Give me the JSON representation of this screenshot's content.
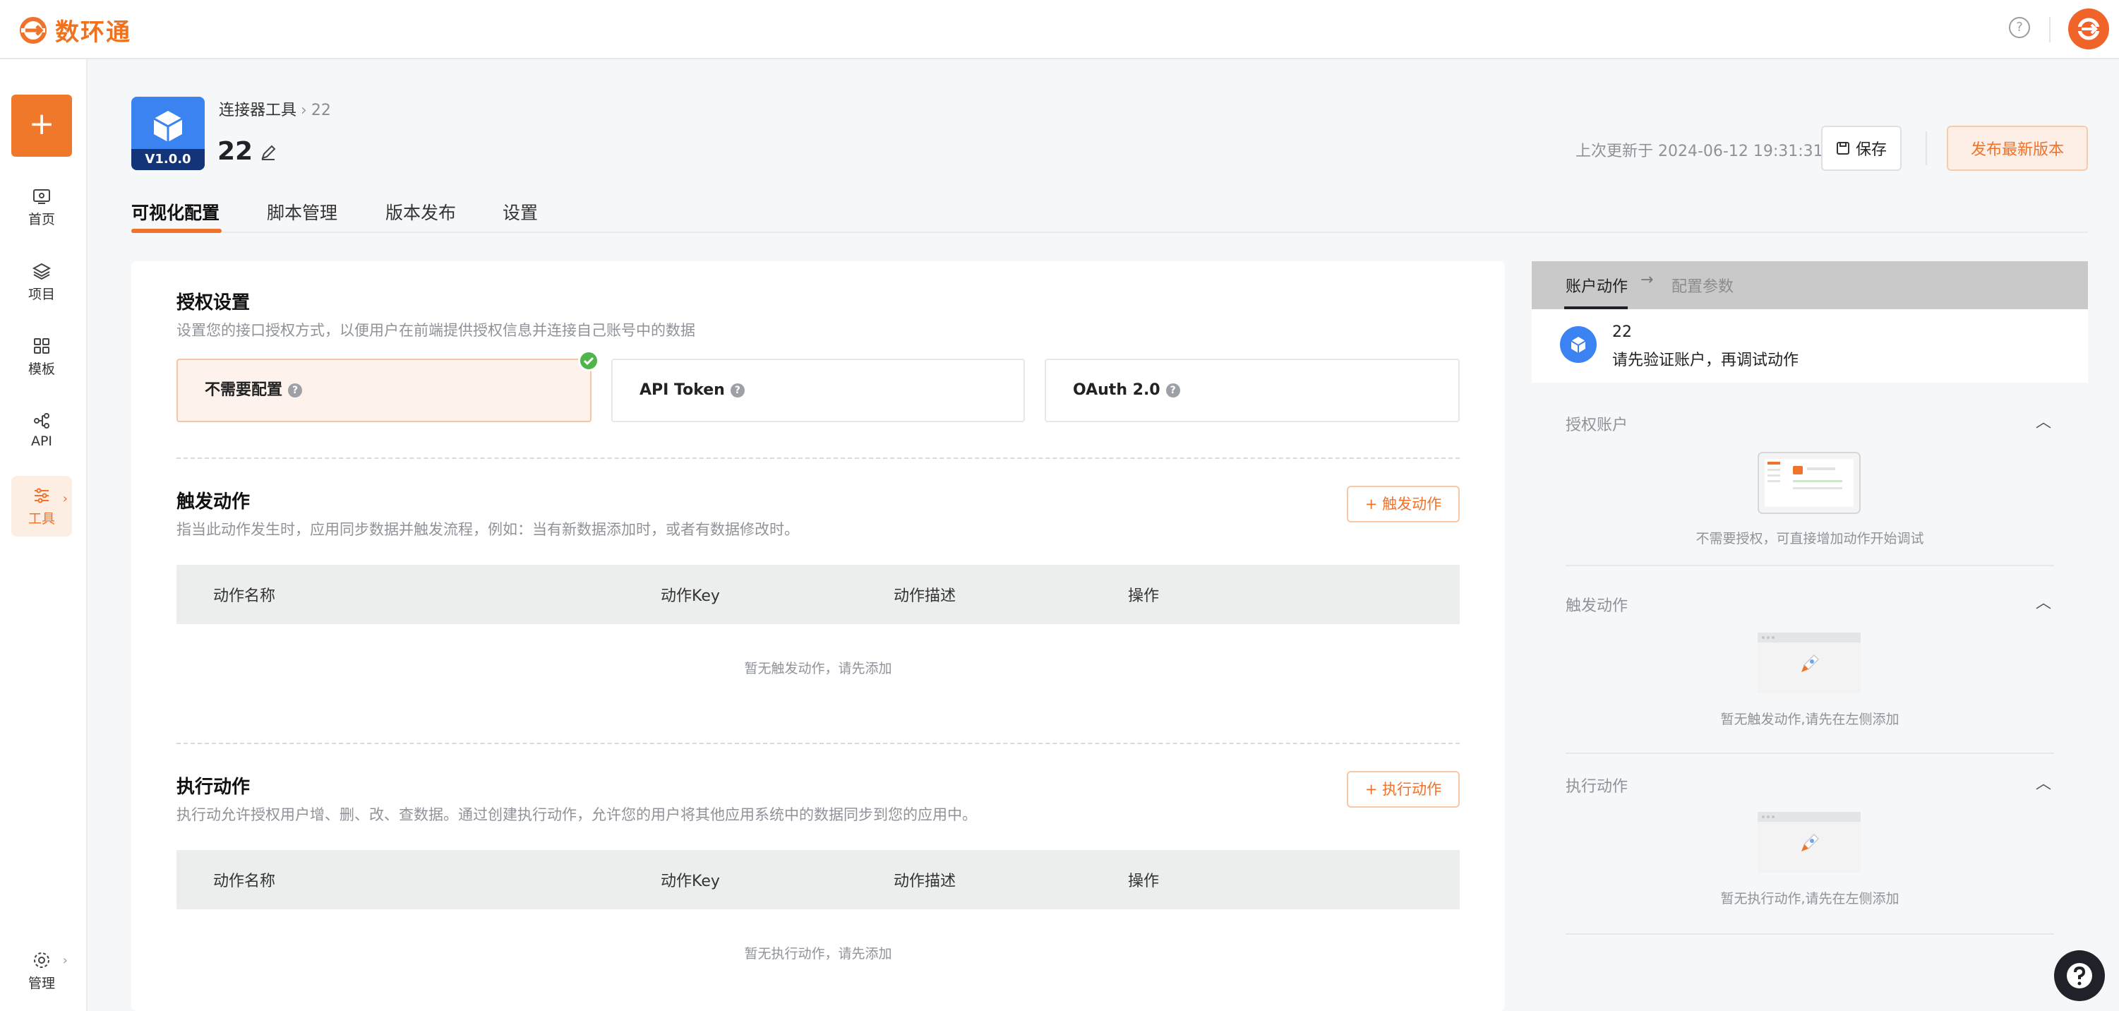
{
  "topbar": {
    "logo_text": "数环通"
  },
  "sidebar": {
    "items": [
      {
        "label": "首页"
      },
      {
        "label": "项目"
      },
      {
        "label": "模板"
      },
      {
        "label": "API"
      },
      {
        "label": "工具"
      }
    ],
    "bottom_label": "管理"
  },
  "header": {
    "version": "V1.0.0",
    "breadcrumb": [
      "连接器工具",
      "22"
    ],
    "title": "22",
    "updated_text": "上次更新于 2024-06-12 19:31:31",
    "save_label": "保存",
    "publish_label": "发布最新版本"
  },
  "tabs": [
    "可视化配置",
    "脚本管理",
    "版本发布",
    "设置"
  ],
  "auth": {
    "title": "授权设置",
    "desc": "设置您的接口授权方式，以便用户在前端提供授权信息并连接自己账号中的数据",
    "options": [
      "不需要配置",
      "API Token",
      "OAuth 2.0"
    ],
    "selected_index": 0
  },
  "trigger": {
    "title": "触发动作",
    "desc": "指当此动作发生时，应用同步数据并触发流程，例如：当有新数据添加时，或者有数据修改时。",
    "button": "+ 触发动作",
    "columns": [
      "动作名称",
      "动作Key",
      "动作描述",
      "操作"
    ],
    "empty": "暂无触发动作，请先添加"
  },
  "action": {
    "title": "执行动作",
    "desc": "执行动允许授权用户增、删、改、查数据。通过创建执行动作，允许您的用户将其他应用系统中的数据同步到您的应用中。",
    "button": "+ 执行动作",
    "columns": [
      "动作名称",
      "动作Key",
      "动作描述",
      "操作"
    ],
    "empty": "暂无执行动作，请先添加"
  },
  "right_panel": {
    "tabs": [
      "账户动作",
      "配置参数"
    ],
    "connector_name": "22",
    "message": "请先验证账户，再调试动作",
    "sections": [
      {
        "title": "授权账户",
        "empty": "不需要授权，可直接增加动作开始调试"
      },
      {
        "title": "触发动作",
        "empty": "暂无触发动作,请先在左侧添加"
      },
      {
        "title": "执行动作",
        "empty": "暂无执行动作,请先在左侧添加"
      }
    ]
  },
  "colors": {
    "accent": "#f0722b",
    "brand_blue": "#3c83f2",
    "success": "#4fb54a"
  }
}
